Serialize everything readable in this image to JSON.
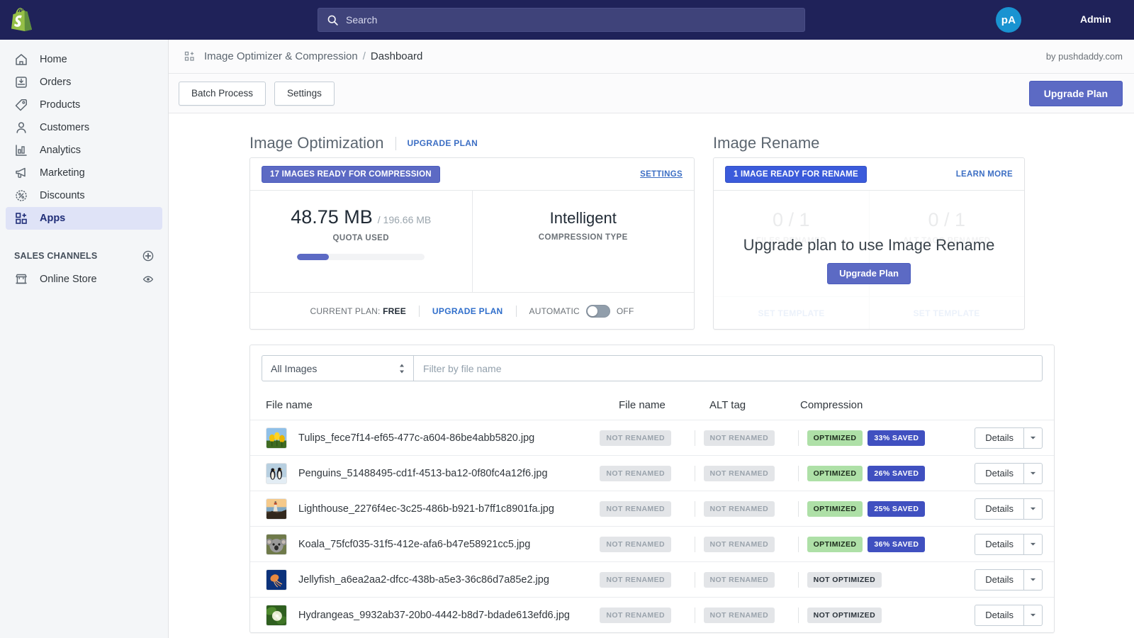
{
  "topbar": {
    "logo_icon": "shopify-logo",
    "search": {
      "icon": "search-icon",
      "value": "",
      "placeholder": "Search"
    },
    "avatar_initials": "pA",
    "admin_label": "Admin"
  },
  "sidebar": {
    "items": [
      {
        "label": "Home",
        "icon": "home-icon",
        "active": false
      },
      {
        "label": "Orders",
        "icon": "orders-icon",
        "active": false
      },
      {
        "label": "Products",
        "icon": "tag-icon",
        "active": false
      },
      {
        "label": "Customers",
        "icon": "person-icon",
        "active": false
      },
      {
        "label": "Analytics",
        "icon": "bar-chart-icon",
        "active": false
      },
      {
        "label": "Marketing",
        "icon": "megaphone-icon",
        "active": false
      },
      {
        "label": "Discounts",
        "icon": "discount-icon",
        "active": false
      },
      {
        "label": "Apps",
        "icon": "apps-icon",
        "active": true
      }
    ],
    "sales_channels": {
      "title": "SALES CHANNELS",
      "add_icon": "plus-circle-icon",
      "channels": [
        {
          "label": "Online Store",
          "icon": "storefront-icon",
          "action_icon": "eye-icon"
        }
      ]
    }
  },
  "breadcrumb": {
    "icon": "apps-icon",
    "app": "Image Optimizer & Compression",
    "separator": "/",
    "page": "Dashboard",
    "by": "by pushdaddy.com"
  },
  "actionbar": {
    "batch_process": "Batch Process",
    "settings": "Settings",
    "upgrade_plan": "Upgrade Plan"
  },
  "optimization": {
    "title": "Image Optimization",
    "title_link": "UPGRADE PLAN",
    "ready_badge": "17 IMAGES READY FOR COMPRESSION",
    "settings_link": "SETTINGS",
    "quota_used": "48.75 MB",
    "quota_total": "/ 196.66 MB",
    "quota_label": "QUOTA USED",
    "quota_percent": 24.8,
    "compression_value": "Intelligent",
    "compression_label": "COMPRESSION TYPE",
    "footer": {
      "current_plan_prefix": "CURRENT PLAN:",
      "current_plan_value": "FREE",
      "upgrade_link": "UPGRADE PLAN",
      "automatic_label": "AUTOMATIC",
      "automatic_state": "OFF"
    }
  },
  "rename": {
    "title": "Image Rename",
    "ready_badge": "1 IMAGE READY FOR RENAME",
    "learn_more": "LEARN MORE",
    "overlay_title": "Upgrade plan to use Image Rename",
    "overlay_button": "Upgrade Plan",
    "ghost": {
      "files_value": "0 / 1",
      "files_label": "FILES RENAMED",
      "alt_value": "0 / 1",
      "alt_label": "ALT TAGS RENAMED",
      "set_template_left": "SET TEMPLATE",
      "set_template_right": "SET TEMPLATE"
    }
  },
  "filters": {
    "select_value": "All Images",
    "select_options": [
      "All Images"
    ],
    "search_value": "",
    "search_placeholder": "Filter by file name"
  },
  "table": {
    "headers": {
      "file": "File name",
      "name": "File name",
      "alt": "ALT tag",
      "compression": "Compression"
    },
    "details_label": "Details",
    "rows": [
      {
        "thumb": "tulips-thumbnail",
        "filename": "Tulips_fece7f14-ef65-477c-a604-86be4abb5820.jpg",
        "name_status": "NOT RENAMED",
        "alt_status": "NOT RENAMED",
        "compression_status": "OPTIMIZED",
        "saved": "33% SAVED"
      },
      {
        "thumb": "penguins-thumbnail",
        "filename": "Penguins_51488495-cd1f-4513-ba12-0f80fc4a12f6.jpg",
        "name_status": "NOT RENAMED",
        "alt_status": "NOT RENAMED",
        "compression_status": "OPTIMIZED",
        "saved": "26% SAVED"
      },
      {
        "thumb": "lighthouse-thumbnail",
        "filename": "Lighthouse_2276f4ec-3c25-486b-b921-b7ff1c8901fa.jpg",
        "name_status": "NOT RENAMED",
        "alt_status": "NOT RENAMED",
        "compression_status": "OPTIMIZED",
        "saved": "25% SAVED"
      },
      {
        "thumb": "koala-thumbnail",
        "filename": "Koala_75fcf035-31f5-412e-afa6-b47e58921cc5.jpg",
        "name_status": "NOT RENAMED",
        "alt_status": "NOT RENAMED",
        "compression_status": "OPTIMIZED",
        "saved": "36% SAVED"
      },
      {
        "thumb": "jellyfish-thumbnail",
        "filename": "Jellyfish_a6ea2aa2-dfcc-438b-a5e3-36c86d7a85e2.jpg",
        "name_status": "NOT RENAMED",
        "alt_status": "NOT RENAMED",
        "compression_status": "NOT OPTIMIZED",
        "saved": ""
      },
      {
        "thumb": "hydrangeas-thumbnail",
        "filename": "Hydrangeas_9932ab37-20b0-4442-b8d7-bdade613efd6.jpg",
        "name_status": "NOT RENAMED",
        "alt_status": "NOT RENAMED",
        "compression_status": "NOT OPTIMIZED",
        "saved": ""
      }
    ]
  },
  "colors": {
    "topbar_bg": "#1f2259",
    "accent_purple": "#5c6ac4",
    "accent_blue_link": "#3d6fc4",
    "badge_green": "#aee0a7",
    "badge_blue": "#4050c0",
    "avatar_blue": "#1993d1",
    "sidebar_active": "#dfe3f7"
  }
}
